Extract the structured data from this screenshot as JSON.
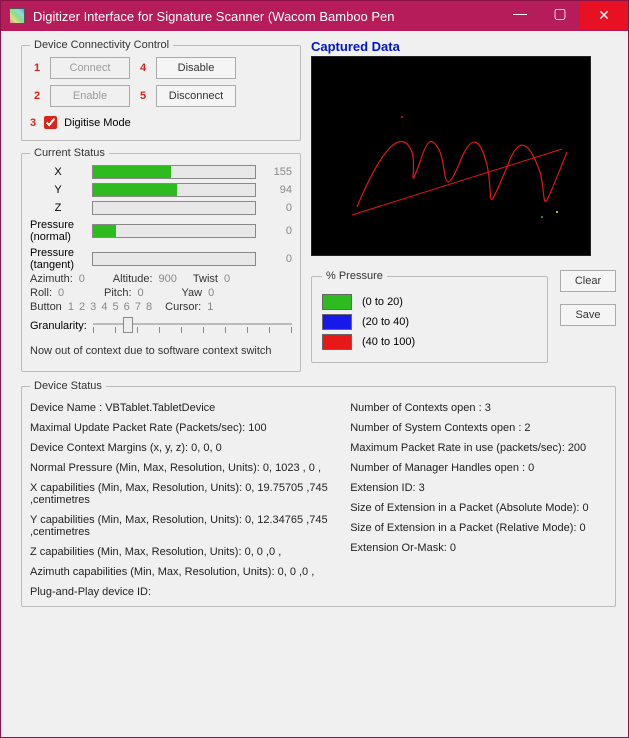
{
  "window": {
    "title": "Digitizer Interface for Signature Scanner (Wacom Bamboo Pen"
  },
  "connectivity": {
    "legend": "Device Connectivity Control",
    "n1": "1",
    "connect": "Connect",
    "n4": "4",
    "disable": "Disable",
    "n2": "2",
    "enable": "Enable",
    "n5": "5",
    "disconnect": "Disconnect",
    "n3": "3",
    "digitise": "Digitise Mode"
  },
  "status": {
    "legend": "Current Status",
    "x_label": "X",
    "x_val": "155",
    "y_label": "Y",
    "y_val": "94",
    "z_label": "Z",
    "z_val": "0",
    "pn_label": "Pressure (normal)",
    "pn_val": "0",
    "pt_label": "Pressure (tangent)",
    "pt_val": "0",
    "azimuth_l": "Azimuth:",
    "azimuth_v": "0",
    "altitude_l": "Altitude:",
    "altitude_v": "900",
    "twist_l": "Twist",
    "twist_v": "0",
    "roll_l": "Roll:",
    "roll_v": "0",
    "pitch_l": "Pitch:",
    "pitch_v": "0",
    "yaw_l": "Yaw",
    "yaw_v": "0",
    "button_l": "Button",
    "buttons": "1  2  3  4  5  6  7  8",
    "cursor_l": "Cursor:",
    "cursor_v": "1",
    "gran_l": "Granularity:",
    "context_note": "Now out of context due to software context switch"
  },
  "captured": {
    "title": "Captured Data",
    "clear": "Clear",
    "save": "Save"
  },
  "pressure_legend": {
    "legend": "% Pressure",
    "r1": "(0 to 20)",
    "r2": "(20 to 40)",
    "r3": "(40 to 100)",
    "c1": "#2dbb1f",
    "c2": "#1818e8",
    "c3": "#e81818"
  },
  "device_status": {
    "legend": "Device Status",
    "l1": "Device Name : VBTablet.TabletDevice",
    "l2": "Maximal Update Packet Rate (Packets/sec): 100",
    "l3": "Device Context Margins (x, y, z): 0, 0, 0",
    "l4": "Normal Pressure (Min, Max, Resolution, Units): 0, 1023 , 0 ,",
    "l5": "X capabilities (Min, Max, Resolution, Units): 0, 19.75705 ,745 ,centimetres",
    "l6": "Y capabilities (Min, Max, Resolution, Units): 0, 12.34765 ,745 ,centimetres",
    "l7": "Z capabilities (Min, Max, Resolution, Units): 0, 0 ,0 ,",
    "l8": "Azimuth capabilities (Min, Max, Resolution, Units): 0, 0 ,0 ,",
    "l9": "Plug-and-Play device ID:",
    "r1": "Number of Contexts open : 3",
    "r2": "Number of System Contexts open : 2",
    "r3": "Maximum Packet Rate in use (packets/sec): 200",
    "r4": "Number of Manager Handles open : 0",
    "r5": "Extension ID: 3",
    "r6": "Size of Extension in a Packet (Absolute Mode): 0",
    "r7": "Size of Extension in a Packet (Relative Mode): 0",
    "r8": "Extension Or-Mask: 0"
  },
  "bars": {
    "x_pct": 48,
    "y_pct": 52,
    "z_pct": 0,
    "pn_pct": 14,
    "pt_pct": 0
  }
}
